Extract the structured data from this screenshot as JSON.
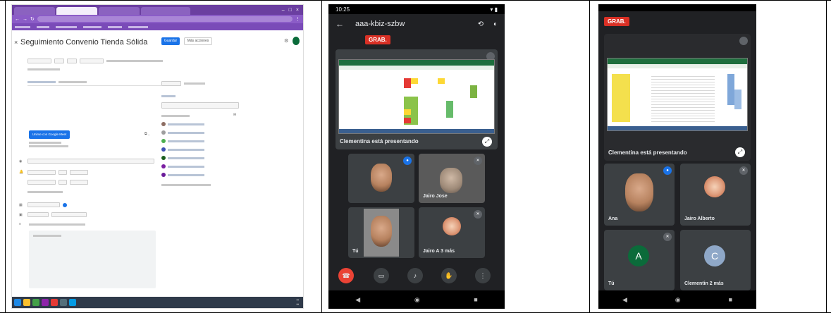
{
  "panel_desktop": {
    "event_title": "Seguimiento Convenio Tienda Sólida",
    "save_label": "Guardar",
    "more_label": "Más acciones",
    "meet_button_label": "Unirse con Google Meet"
  },
  "panel_phone1": {
    "status_time": "10:25",
    "meeting_code": "aaa-kbiz-szbw",
    "recording_badge": "GRAB.",
    "presenting_label": "Clementina está presentando",
    "participants": [
      {
        "name": ""
      },
      {
        "name": "Jairo Jose"
      },
      {
        "name": "Tú"
      },
      {
        "name": "Jairo A 3 más"
      }
    ]
  },
  "panel_phone2": {
    "recording_badge": "GRAB.",
    "presenting_label": "Clementina está presentando",
    "participants": [
      {
        "name": "Ana"
      },
      {
        "name": "Jairo Alberto"
      },
      {
        "name": "Tú",
        "initial": "A"
      },
      {
        "name": "Clementin 2 más",
        "initial": "C"
      }
    ]
  },
  "colors": {
    "recording": "#d93025",
    "hangup": "#ea4335",
    "meet_blue": "#1a73e8",
    "browser_purple": "#6b3fa0"
  }
}
